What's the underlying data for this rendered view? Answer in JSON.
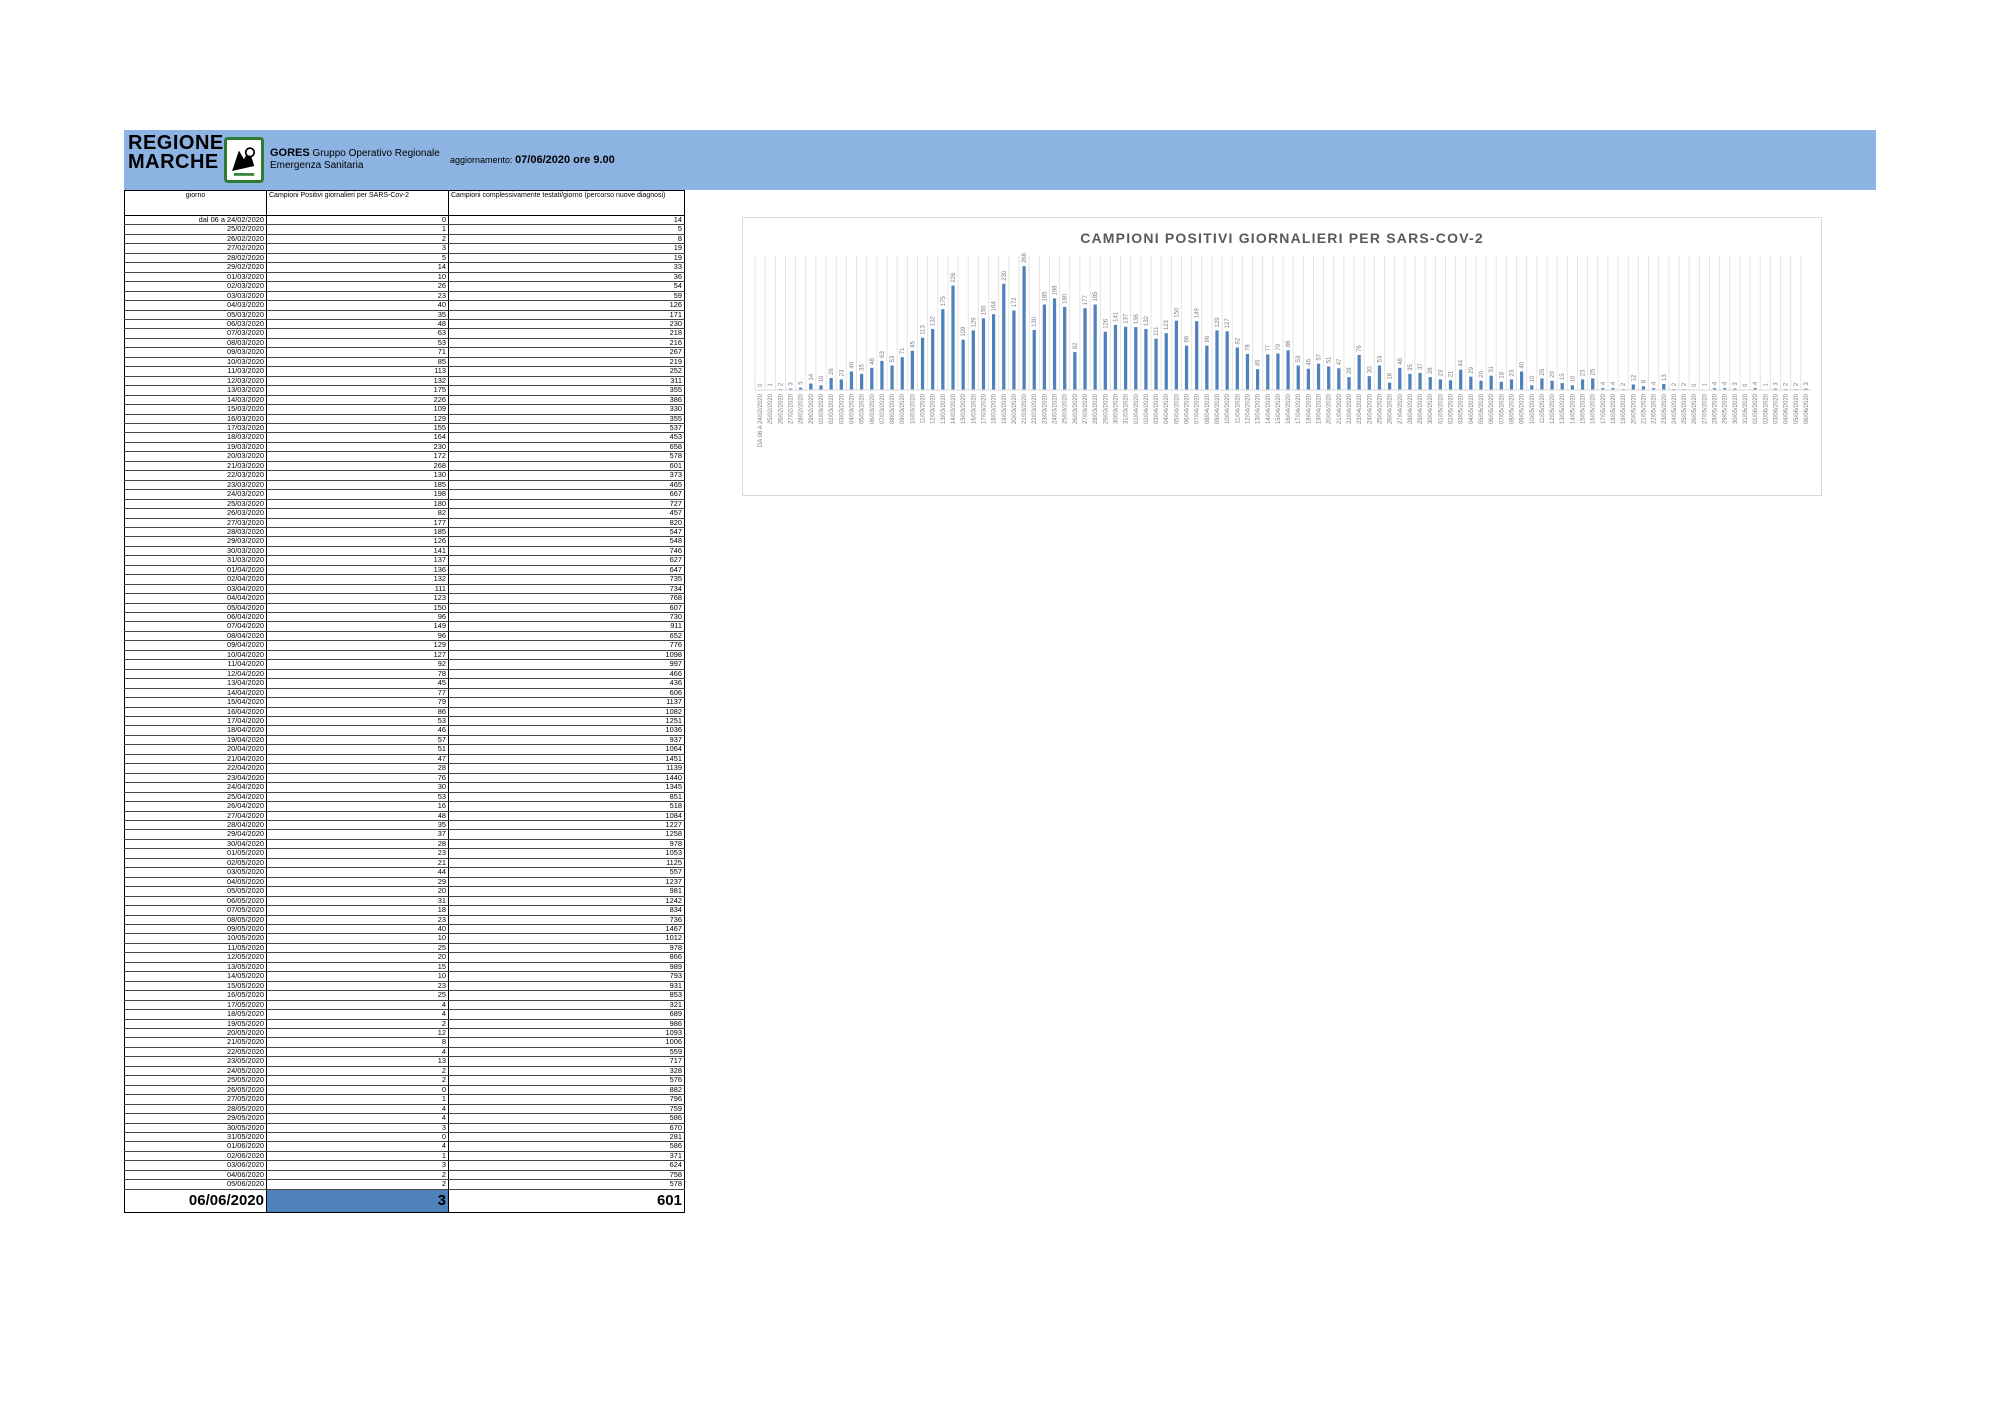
{
  "header": {
    "logo_text_line1": "REGIONE",
    "logo_text_line2": "MARCHE",
    "gores_title": "GORES",
    "gores_subtitle1": "Gruppo Operativo Regionale",
    "gores_subtitle2": "Emergenza Sanitaria",
    "update_label": "aggiornamento:",
    "update_value": "07/06/2020 ore 9.00",
    "banner_color": "#8db3e2"
  },
  "table": {
    "headers": [
      "giorno",
      "Campioni Positivi giornalieri per SARS-Cov-2",
      "Campioni complessivamente testati/giorno (percorso nuove diagnosi)"
    ],
    "rows": [
      [
        "dal 06 a 24/02/2020",
        "0",
        "14"
      ],
      [
        "25/02/2020",
        "1",
        "5"
      ],
      [
        "26/02/2020",
        "2",
        "8"
      ],
      [
        "27/02/2020",
        "3",
        "19"
      ],
      [
        "28/02/2020",
        "5",
        "19"
      ],
      [
        "29/02/2020",
        "14",
        "33"
      ],
      [
        "01/03/2020",
        "10",
        "36"
      ],
      [
        "02/03/2020",
        "26",
        "54"
      ],
      [
        "03/03/2020",
        "23",
        "59"
      ],
      [
        "04/03/2020",
        "40",
        "126"
      ],
      [
        "05/03/2020",
        "35",
        "171"
      ],
      [
        "06/03/2020",
        "48",
        "230"
      ],
      [
        "07/03/2020",
        "63",
        "218"
      ],
      [
        "08/03/2020",
        "53",
        "216"
      ],
      [
        "09/03/2020",
        "71",
        "267"
      ],
      [
        "10/03/2020",
        "85",
        "219"
      ],
      [
        "11/03/2020",
        "113",
        "252"
      ],
      [
        "12/03/2020",
        "132",
        "311"
      ],
      [
        "13/03/2020",
        "175",
        "355"
      ],
      [
        "14/03/2020",
        "226",
        "386"
      ],
      [
        "15/03/2020",
        "109",
        "330"
      ],
      [
        "16/03/2020",
        "129",
        "355"
      ],
      [
        "17/03/2020",
        "155",
        "537"
      ],
      [
        "18/03/2020",
        "164",
        "453"
      ],
      [
        "19/03/2020",
        "230",
        "658"
      ],
      [
        "20/03/2020",
        "172",
        "578"
      ],
      [
        "21/03/2020",
        "268",
        "601"
      ],
      [
        "22/03/2020",
        "130",
        "373"
      ],
      [
        "23/03/2020",
        "185",
        "465"
      ],
      [
        "24/03/2020",
        "198",
        "667"
      ],
      [
        "25/03/2020",
        "180",
        "727"
      ],
      [
        "26/03/2020",
        "82",
        "457"
      ],
      [
        "27/03/2020",
        "177",
        "820"
      ],
      [
        "28/03/2020",
        "185",
        "547"
      ],
      [
        "29/03/2020",
        "126",
        "548"
      ],
      [
        "30/03/2020",
        "141",
        "746"
      ],
      [
        "31/03/2020",
        "137",
        "627"
      ],
      [
        "01/04/2020",
        "136",
        "647"
      ],
      [
        "02/04/2020",
        "132",
        "735"
      ],
      [
        "03/04/2020",
        "111",
        "734"
      ],
      [
        "04/04/2020",
        "123",
        "768"
      ],
      [
        "05/04/2020",
        "150",
        "607"
      ],
      [
        "06/04/2020",
        "96",
        "730"
      ],
      [
        "07/04/2020",
        "149",
        "911"
      ],
      [
        "08/04/2020",
        "96",
        "652"
      ],
      [
        "09/04/2020",
        "129",
        "776"
      ],
      [
        "10/04/2020",
        "127",
        "1098"
      ],
      [
        "11/04/2020",
        "92",
        "997"
      ],
      [
        "12/04/2020",
        "78",
        "466"
      ],
      [
        "13/04/2020",
        "45",
        "436"
      ],
      [
        "14/04/2020",
        "77",
        "606"
      ],
      [
        "15/04/2020",
        "79",
        "1137"
      ],
      [
        "16/04/2020",
        "86",
        "1082"
      ],
      [
        "17/04/2020",
        "53",
        "1251"
      ],
      [
        "18/04/2020",
        "46",
        "1036"
      ],
      [
        "19/04/2020",
        "57",
        "937"
      ],
      [
        "20/04/2020",
        "51",
        "1064"
      ],
      [
        "21/04/2020",
        "47",
        "1451"
      ],
      [
        "22/04/2020",
        "28",
        "1139"
      ],
      [
        "23/04/2020",
        "76",
        "1440"
      ],
      [
        "24/04/2020",
        "30",
        "1345"
      ],
      [
        "25/04/2020",
        "53",
        "851"
      ],
      [
        "26/04/2020",
        "16",
        "518"
      ],
      [
        "27/04/2020",
        "48",
        "1084"
      ],
      [
        "28/04/2020",
        "35",
        "1227"
      ],
      [
        "29/04/2020",
        "37",
        "1258"
      ],
      [
        "30/04/2020",
        "28",
        "978"
      ],
      [
        "01/05/2020",
        "23",
        "1053"
      ],
      [
        "02/05/2020",
        "21",
        "1125"
      ],
      [
        "03/05/2020",
        "44",
        "557"
      ],
      [
        "04/05/2020",
        "29",
        "1237"
      ],
      [
        "05/05/2020",
        "20",
        "981"
      ],
      [
        "06/05/2020",
        "31",
        "1242"
      ],
      [
        "07/05/2020",
        "18",
        "834"
      ],
      [
        "08/05/2020",
        "23",
        "736"
      ],
      [
        "09/05/2020",
        "40",
        "1467"
      ],
      [
        "10/05/2020",
        "10",
        "1012"
      ],
      [
        "11/05/2020",
        "25",
        "978"
      ],
      [
        "12/05/2020",
        "20",
        "866"
      ],
      [
        "13/05/2020",
        "15",
        "989"
      ],
      [
        "14/05/2020",
        "10",
        "793"
      ],
      [
        "15/05/2020",
        "23",
        "931"
      ],
      [
        "16/05/2020",
        "25",
        "853"
      ],
      [
        "17/05/2020",
        "4",
        "321"
      ],
      [
        "18/05/2020",
        "4",
        "689"
      ],
      [
        "19/05/2020",
        "2",
        "986"
      ],
      [
        "20/05/2020",
        "12",
        "1093"
      ],
      [
        "21/05/2020",
        "8",
        "1006"
      ],
      [
        "22/05/2020",
        "4",
        "559"
      ],
      [
        "23/05/2020",
        "13",
        "717"
      ],
      [
        "24/05/2020",
        "2",
        "328"
      ],
      [
        "25/05/2020",
        "2",
        "576"
      ],
      [
        "26/05/2020",
        "0",
        "882"
      ],
      [
        "27/05/2020",
        "1",
        "796"
      ],
      [
        "28/05/2020",
        "4",
        "759"
      ],
      [
        "29/05/2020",
        "4",
        "586"
      ],
      [
        "30/05/2020",
        "3",
        "670"
      ],
      [
        "31/05/2020",
        "0",
        "281"
      ],
      [
        "01/06/2020",
        "4",
        "586"
      ],
      [
        "02/06/2020",
        "1",
        "371"
      ],
      [
        "03/06/2020",
        "3",
        "624"
      ],
      [
        "04/06/2020",
        "2",
        "758"
      ],
      [
        "05/06/2020",
        "2",
        "578"
      ]
    ],
    "total_row": [
      "06/06/2020",
      "3",
      "601"
    ],
    "highlight_color": "#4f81bd"
  },
  "chart_data": {
    "type": "bar",
    "title": "CAMPIONI POSITIVI GIORNALIERI PER SARS-COV-2",
    "bar_color": "#4f81bd",
    "grid": true,
    "legend": "none",
    "categories": [
      "DA 06 A 24/02/2020",
      "25/02/2020",
      "26/02/2020",
      "27/02/2020",
      "28/02/2020",
      "29/02/2020",
      "01/03/2020",
      "02/03/2020",
      "03/03/2020",
      "04/03/2020",
      "05/03/2020",
      "06/03/2020",
      "07/03/2020",
      "08/03/2020",
      "09/03/2020",
      "10/03/2020",
      "11/03/2020",
      "12/03/2020",
      "13/03/2020",
      "14/03/2020",
      "15/03/2020",
      "16/03/2020",
      "17/03/2020",
      "18/03/2020",
      "19/03/2020",
      "20/03/2020",
      "21/03/2020",
      "22/03/2020",
      "23/03/2020",
      "24/03/2020",
      "25/03/2020",
      "26/03/2020",
      "27/03/2020",
      "28/03/2020",
      "29/03/2020",
      "30/03/2020",
      "31/03/2020",
      "01/04/2020",
      "02/04/2020",
      "03/04/2020",
      "04/04/2020",
      "05/04/2020",
      "06/04/2020",
      "07/04/2020",
      "08/04/2020",
      "09/04/2020",
      "10/04/2020",
      "11/04/2020",
      "12/04/2020",
      "13/04/2020",
      "14/04/2020",
      "15/04/2020",
      "16/04/2020",
      "17/04/2020",
      "18/04/2020",
      "19/04/2020",
      "20/04/2020",
      "21/04/2020",
      "22/04/2020",
      "23/04/2020",
      "24/04/2020",
      "25/04/2020",
      "26/04/2020",
      "27/04/2020",
      "28/04/2020",
      "29/04/2020",
      "30/04/2020",
      "01/05/2020",
      "02/05/2020",
      "03/05/2020",
      "04/05/2020",
      "05/05/2020",
      "06/05/2020",
      "07/05/2020",
      "08/05/2020",
      "09/05/2020",
      "10/05/2020",
      "11/05/2020",
      "12/05/2020",
      "13/05/2020",
      "14/05/2020",
      "15/05/2020",
      "16/05/2020",
      "17/05/2020",
      "18/05/2020",
      "19/05/2020",
      "20/05/2020",
      "21/05/2020",
      "22/05/2020",
      "23/05/2020",
      "24/05/2020",
      "25/05/2020",
      "26/05/2020",
      "27/05/2020",
      "28/05/2020",
      "29/05/2020",
      "30/05/2020",
      "31/05/2020",
      "01/06/2020",
      "02/06/2020",
      "03/06/2020",
      "04/06/2020",
      "05/06/2020",
      "06/06/2020"
    ],
    "values": [
      0,
      1,
      2,
      3,
      5,
      14,
      10,
      26,
      23,
      40,
      35,
      48,
      63,
      53,
      71,
      85,
      113,
      132,
      175,
      226,
      109,
      129,
      155,
      164,
      230,
      172,
      268,
      130,
      185,
      198,
      180,
      82,
      177,
      185,
      126,
      141,
      137,
      136,
      132,
      111,
      123,
      150,
      96,
      149,
      96,
      129,
      127,
      92,
      78,
      45,
      77,
      79,
      86,
      53,
      46,
      57,
      51,
      47,
      28,
      76,
      30,
      53,
      16,
      48,
      35,
      37,
      28,
      23,
      21,
      44,
      29,
      20,
      31,
      18,
      23,
      40,
      10,
      25,
      20,
      15,
      10,
      23,
      25,
      4,
      4,
      2,
      12,
      8,
      4,
      13,
      2,
      2,
      0,
      1,
      4,
      4,
      3,
      0,
      4,
      1,
      3,
      2,
      2,
      3
    ],
    "ylim": [
      0,
      290
    ]
  }
}
